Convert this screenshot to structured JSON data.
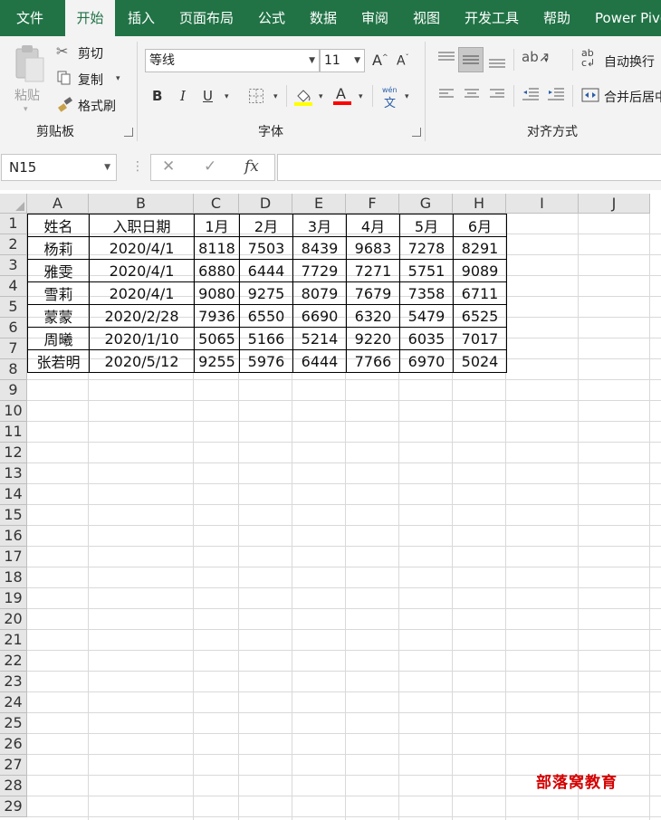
{
  "tabs": [
    {
      "label": "文件",
      "active": false
    },
    {
      "label": "开始",
      "active": true
    },
    {
      "label": "插入",
      "active": false
    },
    {
      "label": "页面布局",
      "active": false
    },
    {
      "label": "公式",
      "active": false
    },
    {
      "label": "数据",
      "active": false
    },
    {
      "label": "审阅",
      "active": false
    },
    {
      "label": "视图",
      "active": false
    },
    {
      "label": "开发工具",
      "active": false
    },
    {
      "label": "帮助",
      "active": false
    },
    {
      "label": "Power Pivot",
      "active": false
    }
  ],
  "ribbon": {
    "clipboard": {
      "paste": "粘贴",
      "cut": "剪切",
      "copy": "复制",
      "format_painter": "格式刷",
      "group_label": "剪贴板"
    },
    "font": {
      "font_name": "等线",
      "font_size": "11",
      "bold": "B",
      "italic": "I",
      "underline": "U",
      "font_color_glyph": "A",
      "phonetic_top": "wén",
      "phonetic_bottom": "文",
      "group_label": "字体",
      "fill_color": "#ffff00",
      "font_color": "#ff0000"
    },
    "alignment": {
      "wrap_text": "自动换行",
      "merge_center": "合并后居中",
      "group_label": "对齐方式"
    }
  },
  "formula_bar": {
    "name_box": "N15",
    "fx": "fx",
    "formula": ""
  },
  "columns": [
    "A",
    "B",
    "C",
    "D",
    "E",
    "F",
    "G",
    "H",
    "I",
    "J"
  ],
  "rows": [
    "1",
    "2",
    "3",
    "4",
    "5",
    "6",
    "7",
    "8",
    "9",
    "10",
    "11",
    "12",
    "13",
    "14",
    "15",
    "16",
    "17",
    "18",
    "19",
    "20",
    "21",
    "22",
    "23",
    "24",
    "25",
    "26",
    "27",
    "28",
    "29"
  ],
  "table": {
    "headers": [
      "姓名",
      "入职日期",
      "1月",
      "2月",
      "3月",
      "4月",
      "5月",
      "6月"
    ],
    "rows": [
      [
        "杨莉",
        "2020/4/1",
        "8118",
        "7503",
        "8439",
        "9683",
        "7278",
        "8291"
      ],
      [
        "雅雯",
        "2020/4/1",
        "6880",
        "6444",
        "7729",
        "7271",
        "5751",
        "9089"
      ],
      [
        "雪莉",
        "2020/4/1",
        "9080",
        "9275",
        "8079",
        "7679",
        "7358",
        "6711"
      ],
      [
        "蒙蒙",
        "2020/2/28",
        "7936",
        "6550",
        "6690",
        "6320",
        "5479",
        "6525"
      ],
      [
        "周曦",
        "2020/1/10",
        "5065",
        "5166",
        "5214",
        "9220",
        "6035",
        "7017"
      ],
      [
        "张若明",
        "2020/5/12",
        "9255",
        "5976",
        "6444",
        "7766",
        "6970",
        "5024"
      ]
    ]
  },
  "watermark": "部落窝教育"
}
